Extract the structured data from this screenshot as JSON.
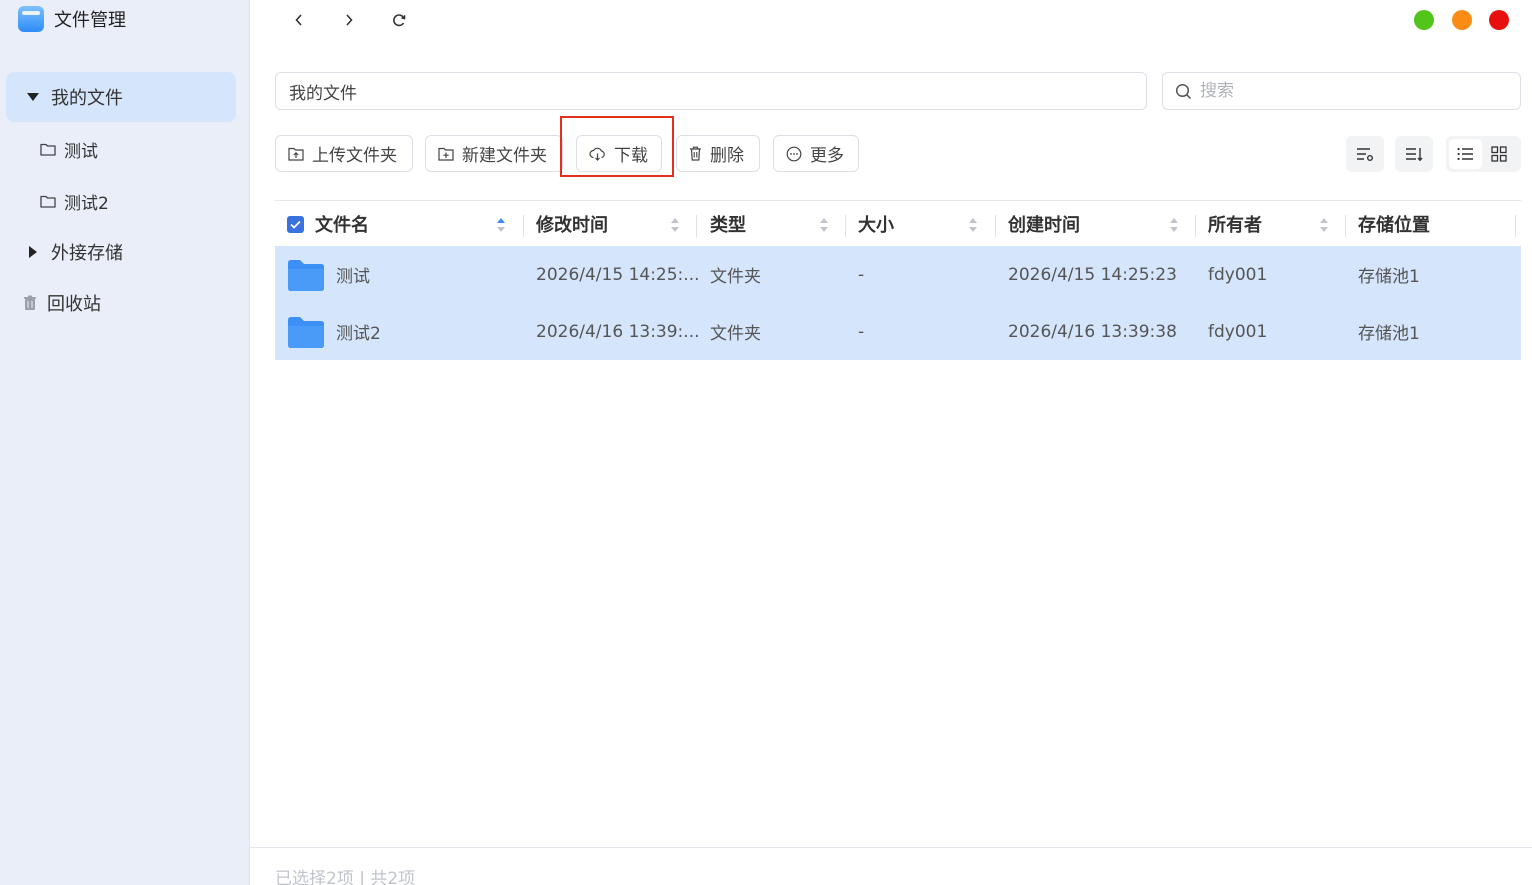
{
  "app": {
    "title": "文件管理"
  },
  "sidebar": {
    "my_files": "我的文件",
    "children": [
      "测试",
      "测试2"
    ],
    "external_storage": "外接存储",
    "recycle_bin": "回收站"
  },
  "path": "我的文件",
  "search": {
    "placeholder": "搜索"
  },
  "toolbar": {
    "upload_folder": "上传文件夹",
    "new_folder": "新建文件夹",
    "download": "下载",
    "delete": "删除",
    "more": "更多"
  },
  "table": {
    "headers": [
      "文件名",
      "修改时间",
      "类型",
      "大小",
      "创建时间",
      "所有者",
      "存储位置"
    ],
    "rows": [
      {
        "name": "测试",
        "modified": "2026/4/15 14:25:...",
        "type": "文件夹",
        "size": "-",
        "created": "2026/4/15 14:25:23",
        "owner": "fdy001",
        "location": "存储池1"
      },
      {
        "name": "测试2",
        "modified": "2026/4/16 13:39:...",
        "type": "文件夹",
        "size": "-",
        "created": "2026/4/16 13:39:38",
        "owner": "fdy001",
        "location": "存储池1"
      }
    ]
  },
  "footer": {
    "status": "已选择2项 | 共2项"
  },
  "colors": {
    "selected_row": "#d4e5fc",
    "sidebar_bg": "#eaeef9",
    "accent": "#3a71e0",
    "folder": "#3b8ff5",
    "highlight": "#e2301f",
    "window_green": "#52c41a",
    "window_orange": "#fa8c16",
    "window_red": "#e8100f"
  }
}
